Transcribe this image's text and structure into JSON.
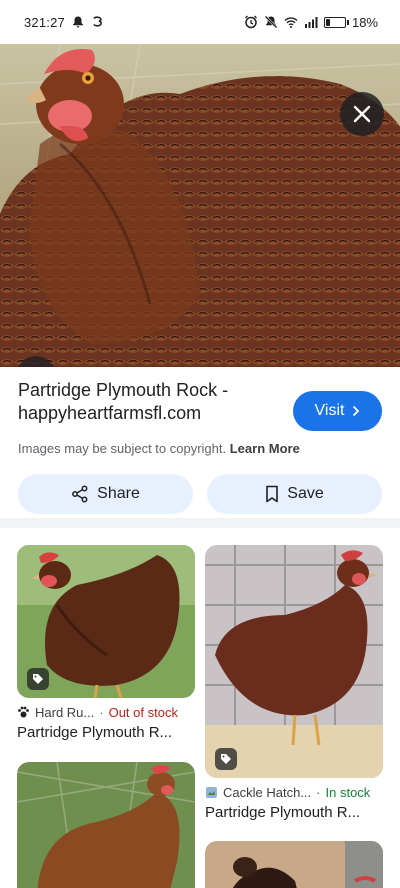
{
  "status_bar": {
    "time": "321:27",
    "battery_percent": "18%",
    "battery_level": 0.18
  },
  "viewer": {
    "close_icon": "close-icon",
    "lens_icon": "lens-icon"
  },
  "result": {
    "title_line1": "Partridge Plymouth Rock -",
    "title_line2": "happyheartfarmsfl.com",
    "visit_label": "Visit",
    "copyright_text": "Images may be subject to copyright.",
    "learn_more": "Learn More",
    "share_label": "Share",
    "save_label": "Save"
  },
  "related": [
    {
      "source": "Hard Ru...",
      "stock": "Out of stock",
      "title": "Partridge Plymouth R..."
    },
    {
      "source": "Cackle Hatch...",
      "stock": "In stock",
      "title": "Partridge Plymouth R..."
    }
  ],
  "colors": {
    "accent": "#1a73e8",
    "chip_bg": "#e8f0fe",
    "out_of_stock": "#b3261e",
    "in_stock": "#188038"
  }
}
